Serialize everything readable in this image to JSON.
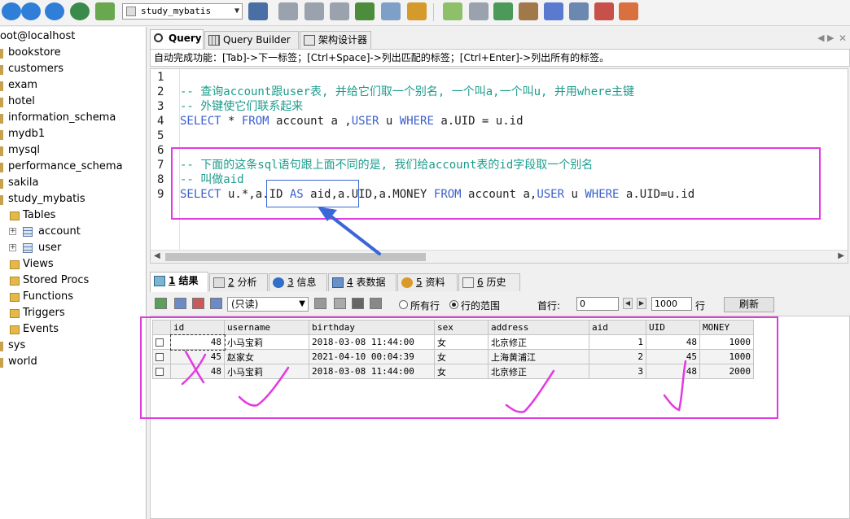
{
  "toolbar": {
    "database": "study_mybatis",
    "icons": [
      "refresh-icon",
      "back-icon",
      "forward-icon",
      "home-icon",
      "tools-icon",
      "user-icon",
      "db-add-icon",
      "db-refresh-icon",
      "db-remove-icon",
      "table-icon",
      "table-grid-icon",
      "chart-icon",
      "pen-icon",
      "database-icon",
      "import-icon",
      "truck-icon",
      "backup-icon",
      "screen-icon",
      "schema-icon",
      "sitemap-icon"
    ]
  },
  "sidebar": {
    "connection": "oot@localhost",
    "databases": [
      "bookstore",
      "customers",
      "exam",
      "hotel",
      "information_schema",
      "mydb1",
      "mysql",
      "performance_schema",
      "sakila",
      "study_mybatis"
    ],
    "study_mybatis": {
      "tables_label": "Tables",
      "tables": [
        "account",
        "user"
      ],
      "folders": [
        "Views",
        "Stored Procs",
        "Functions",
        "Triggers",
        "Events"
      ]
    },
    "after": [
      "sys",
      "world"
    ]
  },
  "tabs": [
    {
      "label": "Query",
      "icon": "search-icon"
    },
    {
      "label": "Query Builder",
      "icon": "table-icon"
    },
    {
      "label": "架构设计器",
      "icon": "schema-icon"
    }
  ],
  "hint": "自动完成功能：[Tab]->下一标签；[Ctrl+Space]->列出匹配的标签；[Ctrl+Enter]->列出所有的标签。",
  "editor": {
    "line_numbers": [
      "1",
      "2",
      "3",
      "4",
      "5",
      "6",
      "7",
      "8",
      "9"
    ],
    "line2": "-- 查询account跟user表, 并给它们取一个别名, 一个叫a,一个叫u, 并用where主键",
    "line3": "-- 外键使它们联系起来",
    "line4": {
      "select": "SELECT",
      "t1": " * ",
      "from": "FROM",
      "t2": " account a ,",
      "user": "USER",
      "t3": " u ",
      "where": "WHERE",
      "t4": " a.UID = u.id"
    },
    "line7": "-- 下面的这条sql语句跟上面不同的是, 我们给account表的id字段取一个别名",
    "line8": "-- 叫做aid",
    "line9": {
      "select": "SELECT",
      "t1": " u.*,a.ID ",
      "as": "AS",
      "t2": " aid,a.UID,a.MONEY ",
      "from": "FROM",
      "t3": " account a,",
      "user": "USER",
      "t4": " u ",
      "where": "WHERE",
      "t5": " a.UID=u.id"
    }
  },
  "result_tabs": [
    {
      "num": "1",
      "label": "结果"
    },
    {
      "num": "2",
      "label": "分析"
    },
    {
      "num": "3",
      "label": "信息"
    },
    {
      "num": "4",
      "label": "表数据"
    },
    {
      "num": "5",
      "label": "资料"
    },
    {
      "num": "6",
      "label": "历史"
    }
  ],
  "result_toolbar": {
    "mode": "(只读)",
    "radio_all": "所有行",
    "radio_range": "行的范围",
    "first_row_label": "首行:",
    "first_row": "0",
    "rows": "1000",
    "rows_label": "行",
    "refresh": "刷新"
  },
  "grid": {
    "columns": [
      "id",
      "username",
      "birthday",
      "sex",
      "address",
      "aid",
      "UID",
      "MONEY"
    ],
    "rows": [
      [
        "48",
        "小马宝莉",
        "2018-03-08 11:44:00",
        "女",
        "北京修正",
        "1",
        "48",
        "1000"
      ],
      [
        "45",
        "赵家女",
        "2021-04-10 00:04:39",
        "女",
        "上海黄浦江",
        "2",
        "45",
        "1000"
      ],
      [
        "48",
        "小马宝莉",
        "2018-03-08 11:44:00",
        "女",
        "北京修正",
        "3",
        "48",
        "2000"
      ]
    ]
  },
  "annotation_color": "#e23ae2"
}
